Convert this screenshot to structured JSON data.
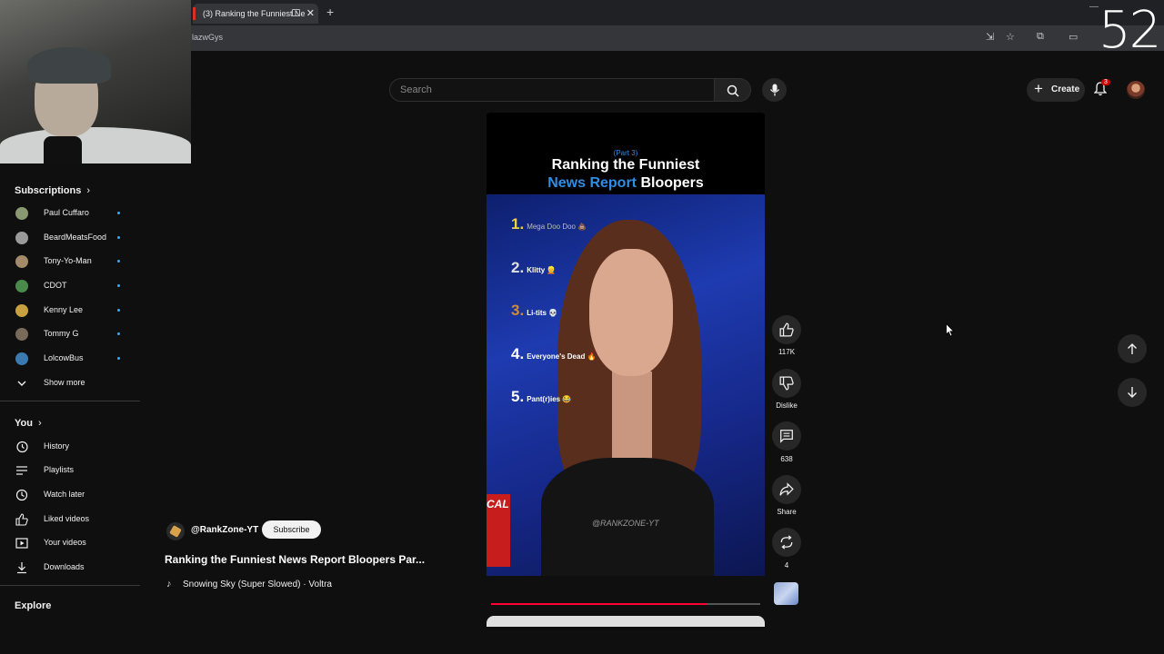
{
  "browser": {
    "tab_title": "(3) Ranking the Funniest Ne",
    "tab_close": "✕",
    "new_tab": "+",
    "url": "lazwGys",
    "overlay_counter": "52"
  },
  "header": {
    "search_placeholder": "Search",
    "create_label": "Create",
    "create_plus": "+",
    "notifications_count": "3"
  },
  "sidebar": {
    "subscriptions_title": "Subscriptions",
    "subscriptions": [
      {
        "name": "Paul Cuffaro",
        "color": "#8a9a70"
      },
      {
        "name": "BeardMeatsFood",
        "color": "#9a9a9a"
      },
      {
        "name": "Tony-Yo-Man",
        "color": "#a58a6a"
      },
      {
        "name": "CDOT",
        "color": "#4a8a4a"
      },
      {
        "name": "Kenny Lee",
        "color": "#c8a040"
      },
      {
        "name": "Tommy G",
        "color": "#7a6a5a"
      },
      {
        "name": "LolcowBus",
        "color": "#3a7ab0"
      }
    ],
    "show_more": "Show more",
    "you_title": "You",
    "you_items": [
      {
        "name": "History",
        "icon": "history-icon"
      },
      {
        "name": "Playlists",
        "icon": "playlists-icon"
      },
      {
        "name": "Watch later",
        "icon": "watch-later-icon"
      },
      {
        "name": "Liked videos",
        "icon": "liked-videos-icon"
      },
      {
        "name": "Your videos",
        "icon": "your-videos-icon"
      },
      {
        "name": "Downloads",
        "icon": "downloads-icon"
      }
    ],
    "explore_title": "Explore"
  },
  "video": {
    "part": "(Part 3)",
    "title_line1": "Ranking the Funniest",
    "title_line2_blue": "News Report",
    "title_line2_white": "Bloopers",
    "rankings": [
      {
        "num": "1.",
        "label": "Mega Doo Doo 💩"
      },
      {
        "num": "2.",
        "label": "Klitty 👱"
      },
      {
        "num": "3.",
        "label": "Li-tits 💀"
      },
      {
        "num": "4.",
        "label": "Everyone's Dead 🔥"
      },
      {
        "num": "5.",
        "label": "Pant(r)ies 😂"
      }
    ],
    "watermark": "@RANKZONE-YT",
    "corner_text": "CAL",
    "progress_percent": 80
  },
  "meta": {
    "channel": "@RankZone-YT",
    "subscribe": "Subscribe",
    "title": "Ranking the Funniest News Report Bloopers Par...",
    "music": "Snowing Sky (Super Slowed) · Voltra"
  },
  "actions": {
    "likes": "117K",
    "dislike": "Dislike",
    "comments": "638",
    "share": "Share",
    "remix": "4"
  }
}
